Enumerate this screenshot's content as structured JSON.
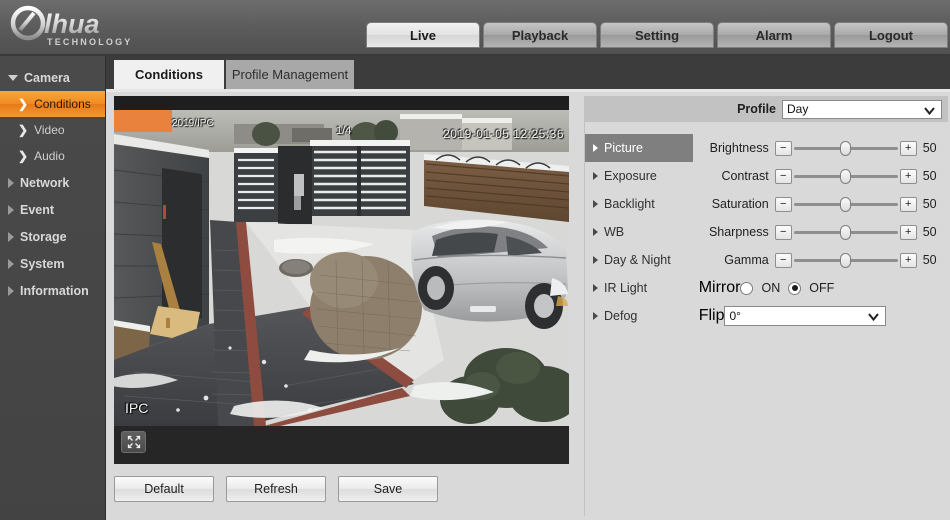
{
  "header": {
    "brand": "alhua",
    "brand_sub": "TECHNOLOGY",
    "nav": [
      {
        "label": "Live",
        "active": true
      },
      {
        "label": "Playback",
        "active": false
      },
      {
        "label": "Setting",
        "active": false
      },
      {
        "label": "Alarm",
        "active": false
      },
      {
        "label": "Logout",
        "active": false
      }
    ]
  },
  "sidebar": {
    "items": [
      {
        "label": "Camera",
        "type": "group",
        "expanded": true
      },
      {
        "label": "Conditions",
        "type": "child",
        "active": true
      },
      {
        "label": "Video",
        "type": "child",
        "active": false
      },
      {
        "label": "Audio",
        "type": "child",
        "active": false
      },
      {
        "label": "Network",
        "type": "group",
        "expanded": false
      },
      {
        "label": "Event",
        "type": "group",
        "expanded": false
      },
      {
        "label": "Storage",
        "type": "group",
        "expanded": false
      },
      {
        "label": "System",
        "type": "group",
        "expanded": false
      },
      {
        "label": "Information",
        "type": "group",
        "expanded": false
      }
    ]
  },
  "content": {
    "tabs": [
      {
        "label": "Conditions",
        "active": true
      },
      {
        "label": "Profile Management",
        "active": false
      }
    ]
  },
  "video": {
    "overlay_channel": "2019/IPC",
    "overlay_fraction": "1/4",
    "overlay_timestamp": "2019-01-05 12:25:36",
    "overlay_name": "IPC",
    "fullscreen_icon": "expand-icon"
  },
  "buttons": {
    "default": "Default",
    "refresh": "Refresh",
    "save": "Save"
  },
  "settings": {
    "profile_label": "Profile",
    "profile_value": "Day",
    "submenu": [
      {
        "label": "Picture",
        "active": true
      },
      {
        "label": "Exposure",
        "active": false
      },
      {
        "label": "Backlight",
        "active": false
      },
      {
        "label": "WB",
        "active": false
      },
      {
        "label": "Day & Night",
        "active": false
      },
      {
        "label": "IR Light",
        "active": false
      },
      {
        "label": "Defog",
        "active": false
      }
    ],
    "sliders": [
      {
        "name": "Brightness",
        "value": "50",
        "min": 0,
        "max": 100
      },
      {
        "name": "Contrast",
        "value": "50",
        "min": 0,
        "max": 100
      },
      {
        "name": "Saturation",
        "value": "50",
        "min": 0,
        "max": 100
      },
      {
        "name": "Sharpness",
        "value": "50",
        "min": 0,
        "max": 100
      },
      {
        "name": "Gamma",
        "value": "50",
        "min": 0,
        "max": 100
      }
    ],
    "minus_label": "−",
    "plus_label": "+",
    "mirror_label": "Mirror",
    "mirror_on_label": "ON",
    "mirror_off_label": "OFF",
    "mirror_selected": "OFF",
    "flip_label": "Flip",
    "flip_value": "0°"
  },
  "colors": {
    "accent": "#f08a20",
    "header_bg": "#5d5d5d",
    "sidebar_bg": "#464646",
    "panel_bg": "#d9d9d9"
  }
}
